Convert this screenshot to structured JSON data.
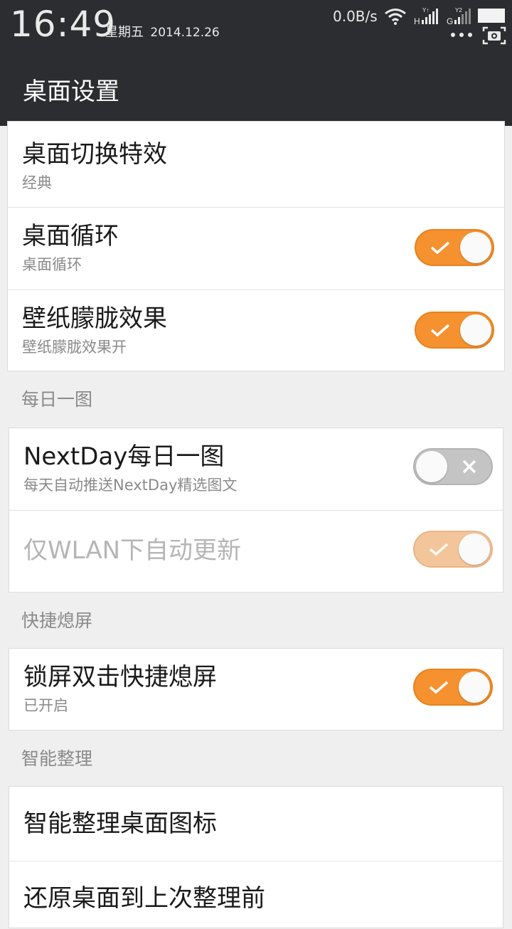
{
  "status_bar": {
    "time": "16:49",
    "weekday": "星期五",
    "date": "2014.12.26",
    "net_speed": "0.0B/s",
    "icons": [
      "wifi-icon",
      "signal-h-icon",
      "signal-g-icon",
      "battery-icon",
      "more-dots-icon",
      "screenshot-camera-icon"
    ]
  },
  "header": {
    "title": "桌面设置"
  },
  "colors": {
    "accent": "#f5912f",
    "header_bg": "#2b2d30",
    "toggle_off": "#c4c4c4"
  },
  "group1": {
    "transition": {
      "title": "桌面切换特效",
      "subtitle": "经典"
    },
    "loop": {
      "title": "桌面循环",
      "subtitle": "桌面循环",
      "enabled": true
    },
    "blur": {
      "title": "壁纸朦胧效果",
      "subtitle": "壁纸朦胧效果开",
      "enabled": true
    }
  },
  "section_daily": {
    "label": "每日一图"
  },
  "group2": {
    "nextday": {
      "title": "NextDay每日一图",
      "subtitle": "每天自动推送NextDay精选图文",
      "enabled": false
    },
    "wlan": {
      "title": "仅WLAN下自动更新",
      "enabled": true,
      "disabled": true
    }
  },
  "section_lock": {
    "label": "快捷熄屏"
  },
  "group3": {
    "lock": {
      "title": "锁屏双击快捷熄屏",
      "subtitle": "已开启",
      "enabled": true
    }
  },
  "section_smart": {
    "label": "智能整理"
  },
  "group4": {
    "organize": {
      "title": "智能整理桌面图标"
    },
    "restore": {
      "title": "还原桌面到上次整理前"
    }
  }
}
